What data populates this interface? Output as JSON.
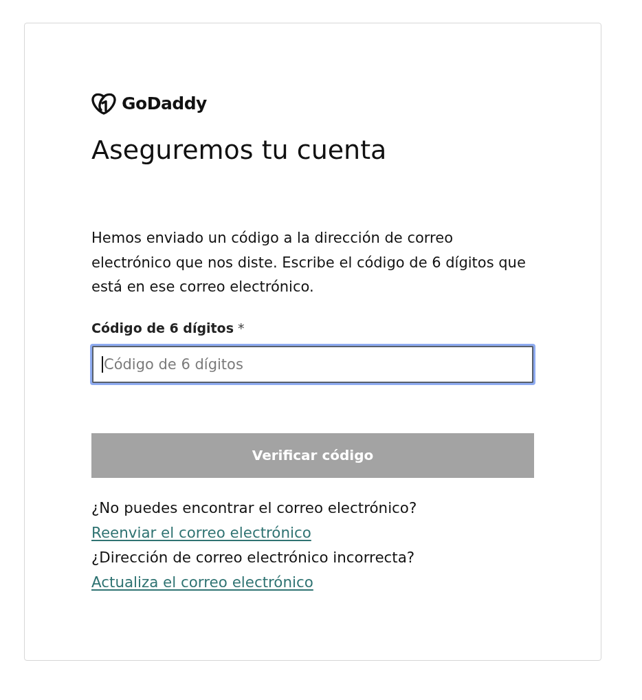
{
  "logo": {
    "text": "GoDaddy"
  },
  "title": "Aseguremos tu cuenta",
  "message": "Hemos enviado un código a la dirección de correo electrónico que nos diste. Escribe el código de 6 dígitos que está en ese correo electrónico.",
  "code_field": {
    "label": "Código de 6 dígitos",
    "required_mark": "*",
    "placeholder": "Código de 6 dígitos",
    "focused": true
  },
  "verify_button": {
    "label": "Verificar código",
    "disabled": true
  },
  "help": [
    {
      "prompt": "¿No puedes encontrar el correo electrónico?",
      "link": "Reenviar el correo electrónico"
    },
    {
      "prompt": "¿Dirección de correo electrónico incorrecta?",
      "link": "Actualiza el correo electrónico"
    }
  ]
}
